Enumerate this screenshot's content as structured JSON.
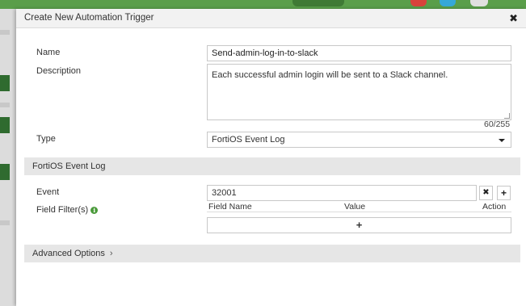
{
  "dialog": {
    "title": "Create New Automation Trigger",
    "close_glyph": "✖"
  },
  "form": {
    "name_label": "Name",
    "name_value": "Send-admin-log-in-to-slack",
    "description_label": "Description",
    "description_value": "Each successful admin login will be sent to a Slack channel.",
    "description_counter": "60/255",
    "type_label": "Type",
    "type_value": "FortiOS Event Log"
  },
  "section": {
    "title": "FortiOS Event Log",
    "event_label": "Event",
    "event_value": "32001",
    "remove_glyph": "✖",
    "add_glyph": "+",
    "field_filters_label": "Field Filter(s)",
    "info_glyph": "i",
    "columns": [
      "Field Name",
      "Value",
      "Action"
    ],
    "add_row_glyph": "+"
  },
  "advanced": {
    "label": "Advanced Options",
    "chevron": "›"
  },
  "colors": {
    "header_green": "#5a9e4a",
    "info_green": "#4a9a3a",
    "section_gray": "#e6e6e6"
  }
}
